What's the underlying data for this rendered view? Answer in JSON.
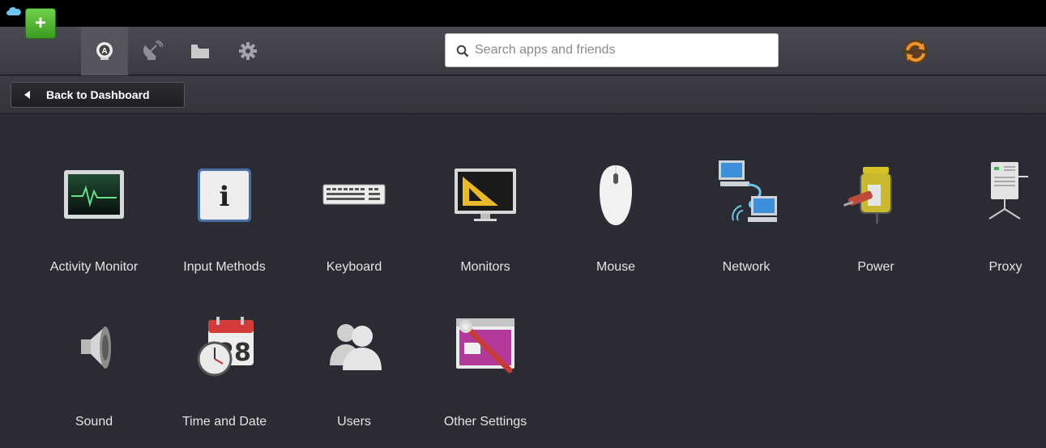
{
  "toolbar": {
    "add_label": "+",
    "search_placeholder": "Search apps and friends"
  },
  "subbar": {
    "back_label": "Back to Dashboard"
  },
  "settings": [
    {
      "label": "Activity Monitor",
      "icon": "activity-monitor-icon"
    },
    {
      "label": "Input Methods",
      "icon": "info-icon"
    },
    {
      "label": "Keyboard",
      "icon": "keyboard-icon"
    },
    {
      "label": "Monitors",
      "icon": "monitor-icon"
    },
    {
      "label": "Mouse",
      "icon": "mouse-icon"
    },
    {
      "label": "Network",
      "icon": "network-icon"
    },
    {
      "label": "Power",
      "icon": "power-plug-icon"
    },
    {
      "label": "Proxy",
      "icon": "proxy-server-icon"
    },
    {
      "label": "Sound",
      "icon": "speaker-icon"
    },
    {
      "label": "Time and Date",
      "icon": "calendar-clock-icon"
    },
    {
      "label": "Users",
      "icon": "users-icon"
    },
    {
      "label": "Other Settings",
      "icon": "tools-icon"
    }
  ],
  "calendar_day": "28",
  "colors": {
    "background": "#2b2c33",
    "add_green": "#4cb52c",
    "sync_orange": "#f0932a"
  }
}
